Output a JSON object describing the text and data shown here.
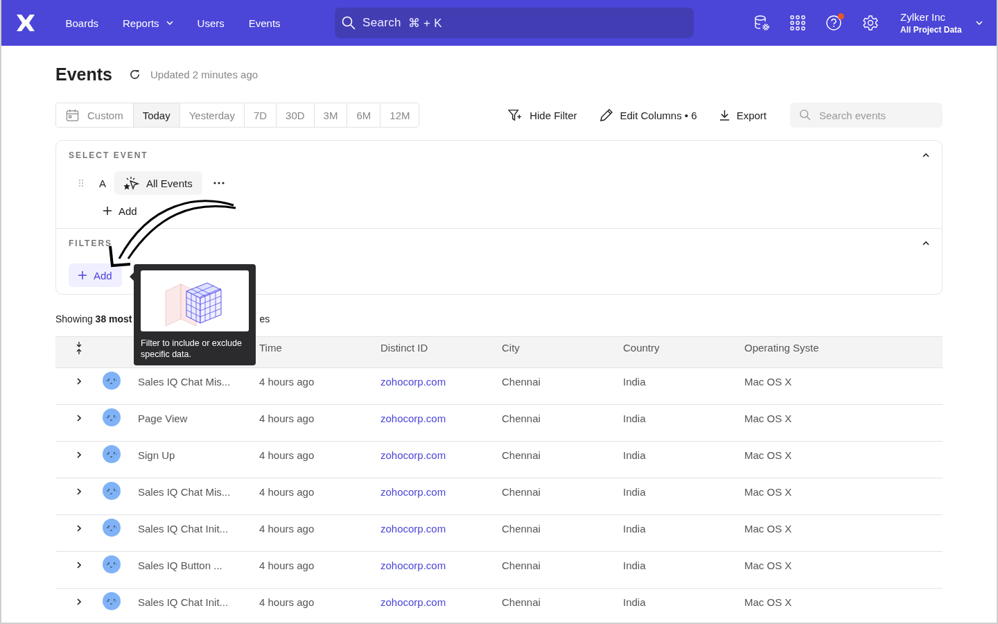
{
  "nav": {
    "items": [
      {
        "label": "Boards",
        "dropdown": false
      },
      {
        "label": "Reports",
        "dropdown": true
      },
      {
        "label": "Users",
        "dropdown": false
      },
      {
        "label": "Events",
        "dropdown": false
      }
    ],
    "search": {
      "placeholder": "Search",
      "shortcut": "⌘ + K"
    },
    "help_badge": true,
    "account": {
      "name": "Zylker Inc",
      "project": "All Project Data"
    }
  },
  "page": {
    "title": "Events",
    "updated": "Updated 2 minutes ago"
  },
  "ranges": [
    {
      "label": "Custom",
      "selected": false
    },
    {
      "label": "Today",
      "selected": true
    },
    {
      "label": "Yesterday",
      "selected": false
    },
    {
      "label": "7D",
      "selected": false
    },
    {
      "label": "30D",
      "selected": false
    },
    {
      "label": "3M",
      "selected": false
    },
    {
      "label": "6M",
      "selected": false
    },
    {
      "label": "12M",
      "selected": false
    }
  ],
  "actions": [
    {
      "kind": "filter",
      "label": "Hide Filter"
    },
    {
      "kind": "edit",
      "label": "Edit Columns • 6"
    },
    {
      "kind": "export",
      "label": "Export"
    }
  ],
  "event_search": {
    "placeholder": "Search events"
  },
  "select_event": {
    "label": "SELECT EVENT",
    "expanded": true,
    "events": [
      {
        "letter": "A",
        "name": "All Events"
      }
    ],
    "add": "Add"
  },
  "filters": {
    "label": "FILTERS",
    "expanded": true,
    "add": "Add"
  },
  "tooltip": {
    "text": "Filter to include or exclude specific data."
  },
  "summary": {
    "visible": "Showing **38 most**",
    "tail": "es"
  },
  "table": {
    "columns": [
      "Time",
      "Distinct ID",
      "City",
      "Country",
      "Operating Syste"
    ],
    "rows": [
      {
        "name": "Sales IQ Chat Mis...",
        "time": "4 hours ago",
        "id": "zohocorp.com",
        "city": "Chennai",
        "country": "India",
        "os": "Mac OS X"
      },
      {
        "name": "Page View",
        "time": "4 hours ago",
        "id": "zohocorp.com",
        "city": "Chennai",
        "country": "India",
        "os": "Mac OS X"
      },
      {
        "name": "Sign Up",
        "time": "4 hours ago",
        "id": "zohocorp.com",
        "city": "Chennai",
        "country": "India",
        "os": "Mac OS X"
      },
      {
        "name": "Sales IQ Chat Mis...",
        "time": "4 hours ago",
        "id": "zohocorp.com",
        "city": "Chennai",
        "country": "India",
        "os": "Mac OS X"
      },
      {
        "name": "Sales IQ Chat Init...",
        "time": "4 hours ago",
        "id": "zohocorp.com",
        "city": "Chennai",
        "country": "India",
        "os": "Mac OS X"
      },
      {
        "name": "Sales IQ Button ...",
        "time": "4 hours ago",
        "id": "zohocorp.com",
        "city": "Chennai",
        "country": "India",
        "os": "Mac OS X"
      },
      {
        "name": "Sales IQ Chat Init...",
        "time": "4 hours ago",
        "id": "zohocorp.com",
        "city": "Chennai",
        "country": "India",
        "os": "Mac OS X"
      }
    ]
  }
}
